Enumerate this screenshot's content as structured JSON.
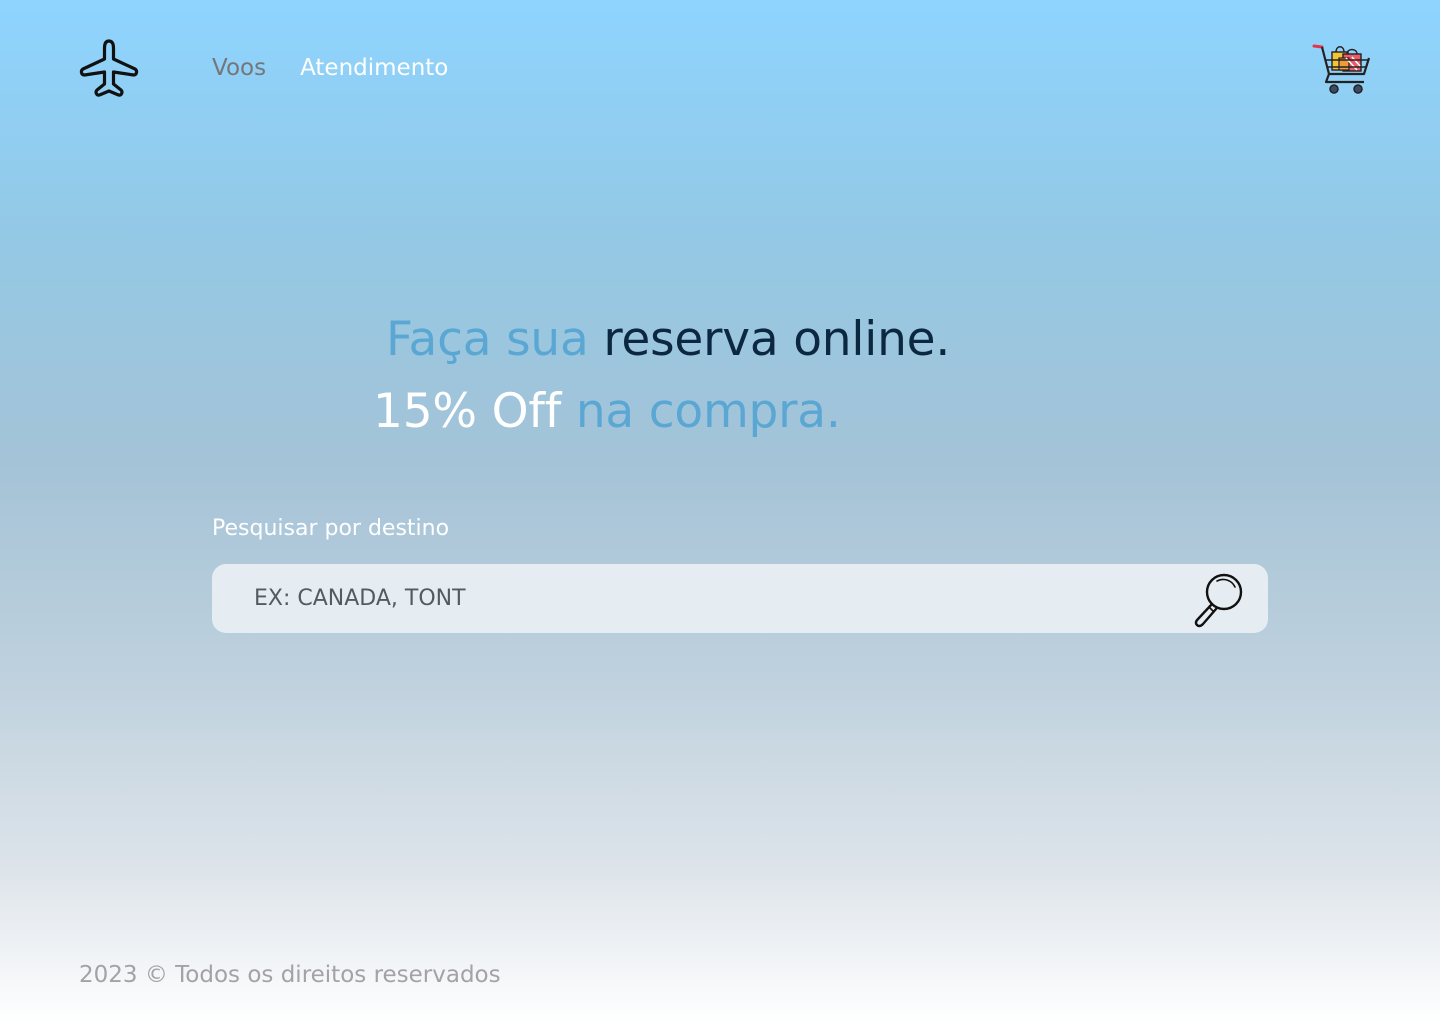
{
  "header": {
    "logo_icon": "airplane-icon",
    "nav": [
      {
        "label": "Voos",
        "color": "#75767b"
      },
      {
        "label": "Atendimento",
        "color": "#ffffff"
      }
    ],
    "cart_icon": "shopping-cart-icon"
  },
  "hero": {
    "line1_part1": "Faça sua",
    "line1_part2": "reserva online.",
    "line2_part1": "15% Off",
    "line2_part2": "na compra."
  },
  "search": {
    "label": "Pesquisar por destino",
    "value": "EX: CANADA, TONT",
    "icon": "magnifier-icon"
  },
  "footer": {
    "text": "2023 © Todos os direitos reservados"
  },
  "colors": {
    "accent_blue": "#5aa7d3",
    "navy": "#0c2840",
    "background_top": "#8ed4ff",
    "background_bottom": "#ffffff"
  }
}
